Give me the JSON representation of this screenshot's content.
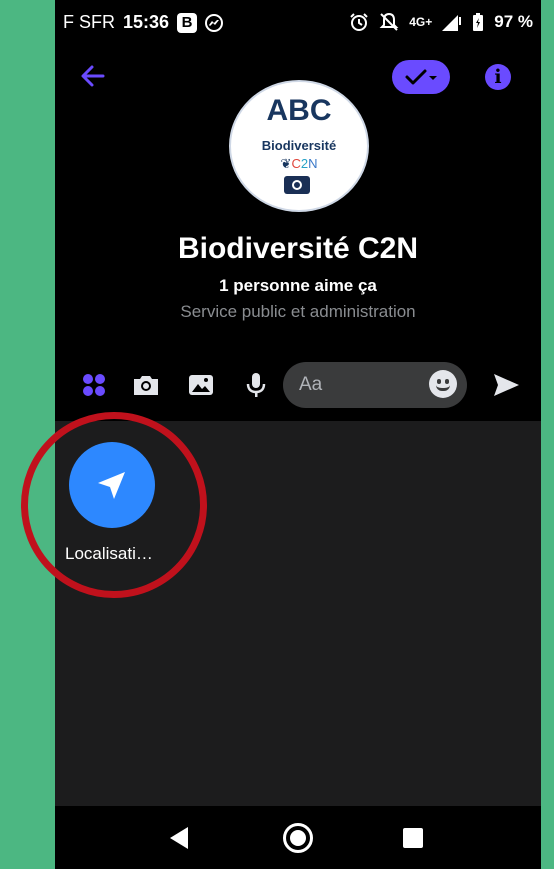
{
  "status_bar": {
    "carrier": "F SFR",
    "time": "15:36",
    "b_badge": "B",
    "network": "4G+",
    "battery": "97 %",
    "icons": [
      "messenger-icon",
      "alarm-icon",
      "mute-icon",
      "signal-icon",
      "battery-icon"
    ]
  },
  "header": {
    "icons": [
      "back-arrow-icon",
      "checkmark-icon",
      "info-icon"
    ],
    "info_glyph": "i"
  },
  "profile": {
    "logo_top": "ABC",
    "logo_line": "Biodiversité",
    "logo_c": "C",
    "logo_2": "2",
    "logo_n": "N",
    "name": "Biodiversité C2N",
    "likes": "1 personne aime ça",
    "category": "Service public et administration"
  },
  "composer": {
    "placeholder": "Aa",
    "icons": [
      "apps-grid-icon",
      "camera-icon",
      "gallery-icon",
      "microphone-icon",
      "emoji-icon",
      "send-icon"
    ]
  },
  "tray": {
    "location_label": "Localisati…",
    "icon": "location-arrow-icon"
  },
  "colors": {
    "accent": "#6a4bff",
    "location": "#2d88ff",
    "highlight": "#c0111c",
    "frame_bg": "#4cb782"
  },
  "navbar": {
    "icons": [
      "nav-back-icon",
      "nav-home-icon",
      "nav-recents-icon"
    ]
  }
}
